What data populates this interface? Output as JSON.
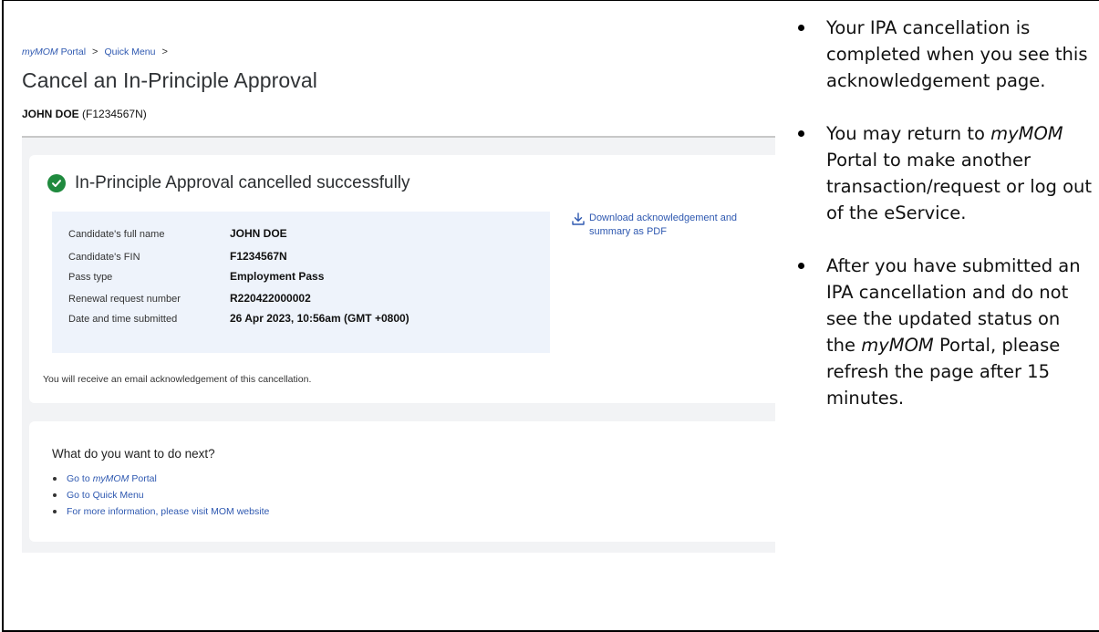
{
  "breadcrumb": {
    "portal": "myMOM",
    "portal_suffix": "Portal",
    "quick_menu": "Quick Menu",
    "separator": ">"
  },
  "page": {
    "title": "Cancel an In-Principle Approval",
    "user_name": "JOHN DOE",
    "user_fin": "(F1234567N)"
  },
  "result": {
    "title": "In-Principle Approval cancelled successfully",
    "summary": [
      {
        "label": "Candidate's full name",
        "value": "JOHN DOE"
      },
      {
        "label": "Candidate's FIN",
        "value": "F1234567N"
      },
      {
        "label": "Pass type",
        "value": "Employment Pass"
      },
      {
        "label": "Renewal request number",
        "value": "R220422000002"
      },
      {
        "label": "Date and time submitted",
        "value": "26 Apr 2023, 10:56am (GMT +0800)"
      }
    ],
    "download_line1": "Download acknowledgement and",
    "download_line2": "summary as PDF",
    "email_note": "You will receive an email acknowledgement of this cancellation."
  },
  "next": {
    "title": "What do you want to do next?",
    "link1_prefix": "Go to",
    "link1_italic": "myMOM",
    "link1_suffix": "Portal",
    "link2": "Go to Quick Menu",
    "link3": "For more information, please visit MOM website"
  },
  "instructions": {
    "b1": "Your IPA cancellation is completed when you see this acknowledgement page.",
    "b2_prefix": "You may return to ",
    "b2_italic": "myMOM",
    "b2_suffix": " Portal to make another transaction/request or log out of the eService.",
    "b3_prefix": "After you have submitted an IPA cancellation and do not see the updated status on the ",
    "b3_italic": "myMOM",
    "b3_suffix": " Portal, please refresh the page after 15 minutes."
  },
  "colors": {
    "link": "#2e58b0",
    "success": "#1f8a3e",
    "summary_bg": "#eef3fb",
    "page_bg": "#f2f3f5"
  }
}
